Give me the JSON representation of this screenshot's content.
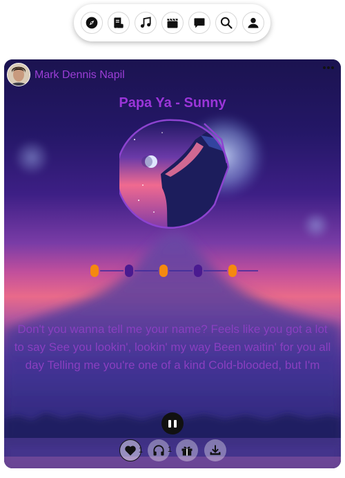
{
  "nav": {
    "items": [
      {
        "name": "explore",
        "icon": "compass-icon"
      },
      {
        "name": "feed",
        "icon": "scroll-icon"
      },
      {
        "name": "music",
        "icon": "music-note-icon"
      },
      {
        "name": "videos",
        "icon": "clapperboard-icon"
      },
      {
        "name": "messages",
        "icon": "chat-bubble-icon"
      },
      {
        "name": "search",
        "icon": "search-icon"
      },
      {
        "name": "profile",
        "icon": "user-icon"
      }
    ]
  },
  "post": {
    "author": "Mark Dennis Napil",
    "more_icon": "more-dots-icon",
    "song_title": "Papa Ya - Sunny",
    "lyrics": "Don't you wanna tell me your name? Feels like you got a lot to say See you lookin', lookin' my way Been waitin' for you all day Telling me you're one of a kind Cold-blooded, but I'm feeling you You could say I'm just a guy",
    "player": {
      "state": "playing",
      "pause_icon": "pause-icon"
    },
    "actions": {
      "like": {
        "icon": "heart-icon",
        "count": "1"
      },
      "listen": {
        "icon": "headphones-icon",
        "count": "1"
      },
      "gift": {
        "icon": "gift-icon"
      },
      "download": {
        "icon": "download-icon"
      }
    },
    "step_dots": {
      "count": 6,
      "colors": [
        "#f5890f",
        "#4a1a90",
        "#f5890f",
        "#4a1a90",
        "#f5890f",
        "#f5890f"
      ]
    }
  },
  "colors": {
    "accent": "#9b35d9",
    "orange": "#f5890f",
    "purple_dot": "#4a1a90"
  }
}
